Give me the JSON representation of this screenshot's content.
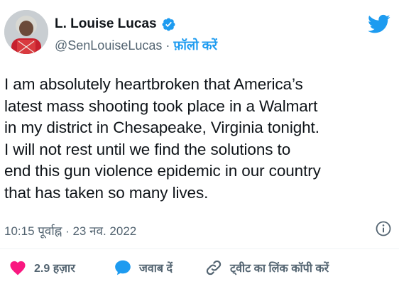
{
  "header": {
    "name": "L. Louise Lucas",
    "handle": "@SenLouiseLucas",
    "separator": " · ",
    "follow_label": "फ़ॉलो करें"
  },
  "tweet": {
    "text": "I am absolutely heartbroken that America’s\nlatest mass shooting took place in a Walmart\nin my district in Chesapeake, Virginia tonight.\nI will not rest until we find the solutions to\nend this gun violence epidemic in our country\nthat has taken so many lives.",
    "timestamp": "10:15 पूर्वाह्न · 23 नव. 2022"
  },
  "actions": {
    "like_count": "2.9 हज़ार",
    "reply_label": "जवाब दें",
    "copy_link_label": "ट्वीट का लिंक कॉपी करें"
  },
  "colors": {
    "brand_blue": "#1d9bf0",
    "like_red": "#f91880",
    "muted": "#536471"
  },
  "icons": {
    "verified": "verified-badge-icon",
    "logo": "twitter-bird-icon",
    "info": "info-icon",
    "like": "heart-icon",
    "reply": "speech-bubble-icon",
    "copy": "link-icon"
  }
}
